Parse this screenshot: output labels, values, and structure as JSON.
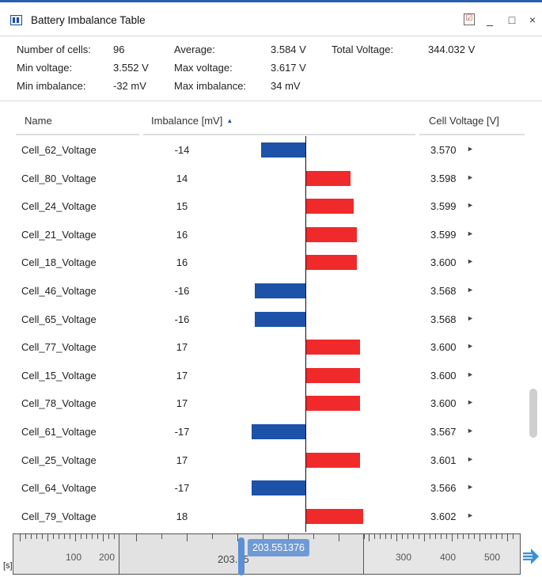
{
  "window": {
    "title": "Battery Imbalance Table",
    "icon": "battery-table-icon",
    "buttons": {
      "check": "☑",
      "minimize": "_",
      "maximize": "□",
      "close": "×"
    }
  },
  "summary": {
    "num_cells_label": "Number of cells:",
    "num_cells": "96",
    "average_label": "Average:",
    "average": "3.584 V",
    "total_voltage_label": "Total Voltage:",
    "total_voltage": "344.032 V",
    "min_voltage_label": "Min voltage:",
    "min_voltage": "3.552 V",
    "max_voltage_label": "Max voltage:",
    "max_voltage": "3.617 V",
    "min_imbalance_label": "Min imbalance:",
    "min_imbalance": "-32 mV",
    "max_imbalance_label": "Max imbalance:",
    "max_imbalance": "34 mV"
  },
  "table": {
    "columns": {
      "name": "Name",
      "imbalance": "Imbalance [mV]",
      "voltage": "Cell Voltage [V]"
    },
    "sort_indicator": "▲",
    "bar_colors": {
      "positive": "#f02a2a",
      "negative": "#1c52a8"
    },
    "rows": [
      {
        "name": "Cell_62_Voltage",
        "imbalance": "-14",
        "imbalance_value": -14,
        "voltage": "3.570"
      },
      {
        "name": "Cell_80_Voltage",
        "imbalance": "14",
        "imbalance_value": 14,
        "voltage": "3.598"
      },
      {
        "name": "Cell_24_Voltage",
        "imbalance": "15",
        "imbalance_value": 15,
        "voltage": "3.599"
      },
      {
        "name": "Cell_21_Voltage",
        "imbalance": "16",
        "imbalance_value": 16,
        "voltage": "3.599"
      },
      {
        "name": "Cell_18_Voltage",
        "imbalance": "16",
        "imbalance_value": 16,
        "voltage": "3.600"
      },
      {
        "name": "Cell_46_Voltage",
        "imbalance": "-16",
        "imbalance_value": -16,
        "voltage": "3.568"
      },
      {
        "name": "Cell_65_Voltage",
        "imbalance": "-16",
        "imbalance_value": -16,
        "voltage": "3.568"
      },
      {
        "name": "Cell_77_Voltage",
        "imbalance": "17",
        "imbalance_value": 17,
        "voltage": "3.600"
      },
      {
        "name": "Cell_15_Voltage",
        "imbalance": "17",
        "imbalance_value": 17,
        "voltage": "3.600"
      },
      {
        "name": "Cell_78_Voltage",
        "imbalance": "17",
        "imbalance_value": 17,
        "voltage": "3.600"
      },
      {
        "name": "Cell_61_Voltage",
        "imbalance": "-17",
        "imbalance_value": -17,
        "voltage": "3.567"
      },
      {
        "name": "Cell_25_Voltage",
        "imbalance": "17",
        "imbalance_value": 17,
        "voltage": "3.601"
      },
      {
        "name": "Cell_64_Voltage",
        "imbalance": "-17",
        "imbalance_value": -17,
        "voltage": "3.566"
      },
      {
        "name": "Cell_79_Voltage",
        "imbalance": "18",
        "imbalance_value": 18,
        "voltage": "3.602"
      }
    ]
  },
  "timeline": {
    "unit": "[s]",
    "left_labels": [
      "100",
      "200"
    ],
    "right_labels": [
      "300",
      "400",
      "500"
    ],
    "cursor_tooltip": "203.551376",
    "cursor_value": "203.55"
  }
}
